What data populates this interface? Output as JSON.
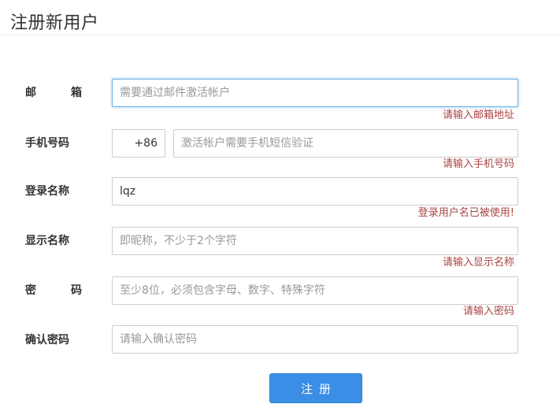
{
  "page": {
    "title": "注册新用户"
  },
  "form": {
    "email": {
      "label_chars": [
        "邮",
        "箱"
      ],
      "placeholder": "需要通过邮件激活帐户",
      "value": "",
      "error": "请输入邮箱地址"
    },
    "phone": {
      "label": "手机号码",
      "prefix": "+86",
      "placeholder": "激活帐户需要手机短信验证",
      "value": "",
      "error": "请输入手机号码"
    },
    "login_name": {
      "label": "登录名称",
      "placeholder": "",
      "value": "lqz",
      "error": "登录用户名已被使用!"
    },
    "display_name": {
      "label": "显示名称",
      "placeholder": "即昵称，不少于2个字符",
      "value": "",
      "error": "请输入显示名称"
    },
    "password": {
      "label_chars": [
        "密",
        "码"
      ],
      "placeholder": "至少8位，必须包含字母、数字、特殊字符",
      "value": "",
      "error": "请输入密码"
    },
    "confirm_password": {
      "label": "确认密码",
      "placeholder": "请输入确认密码",
      "value": ""
    },
    "submit_label": "注册"
  },
  "colors": {
    "accent": "#3a8ee6",
    "error": "#a94442",
    "focus_border": "#66afe9"
  }
}
